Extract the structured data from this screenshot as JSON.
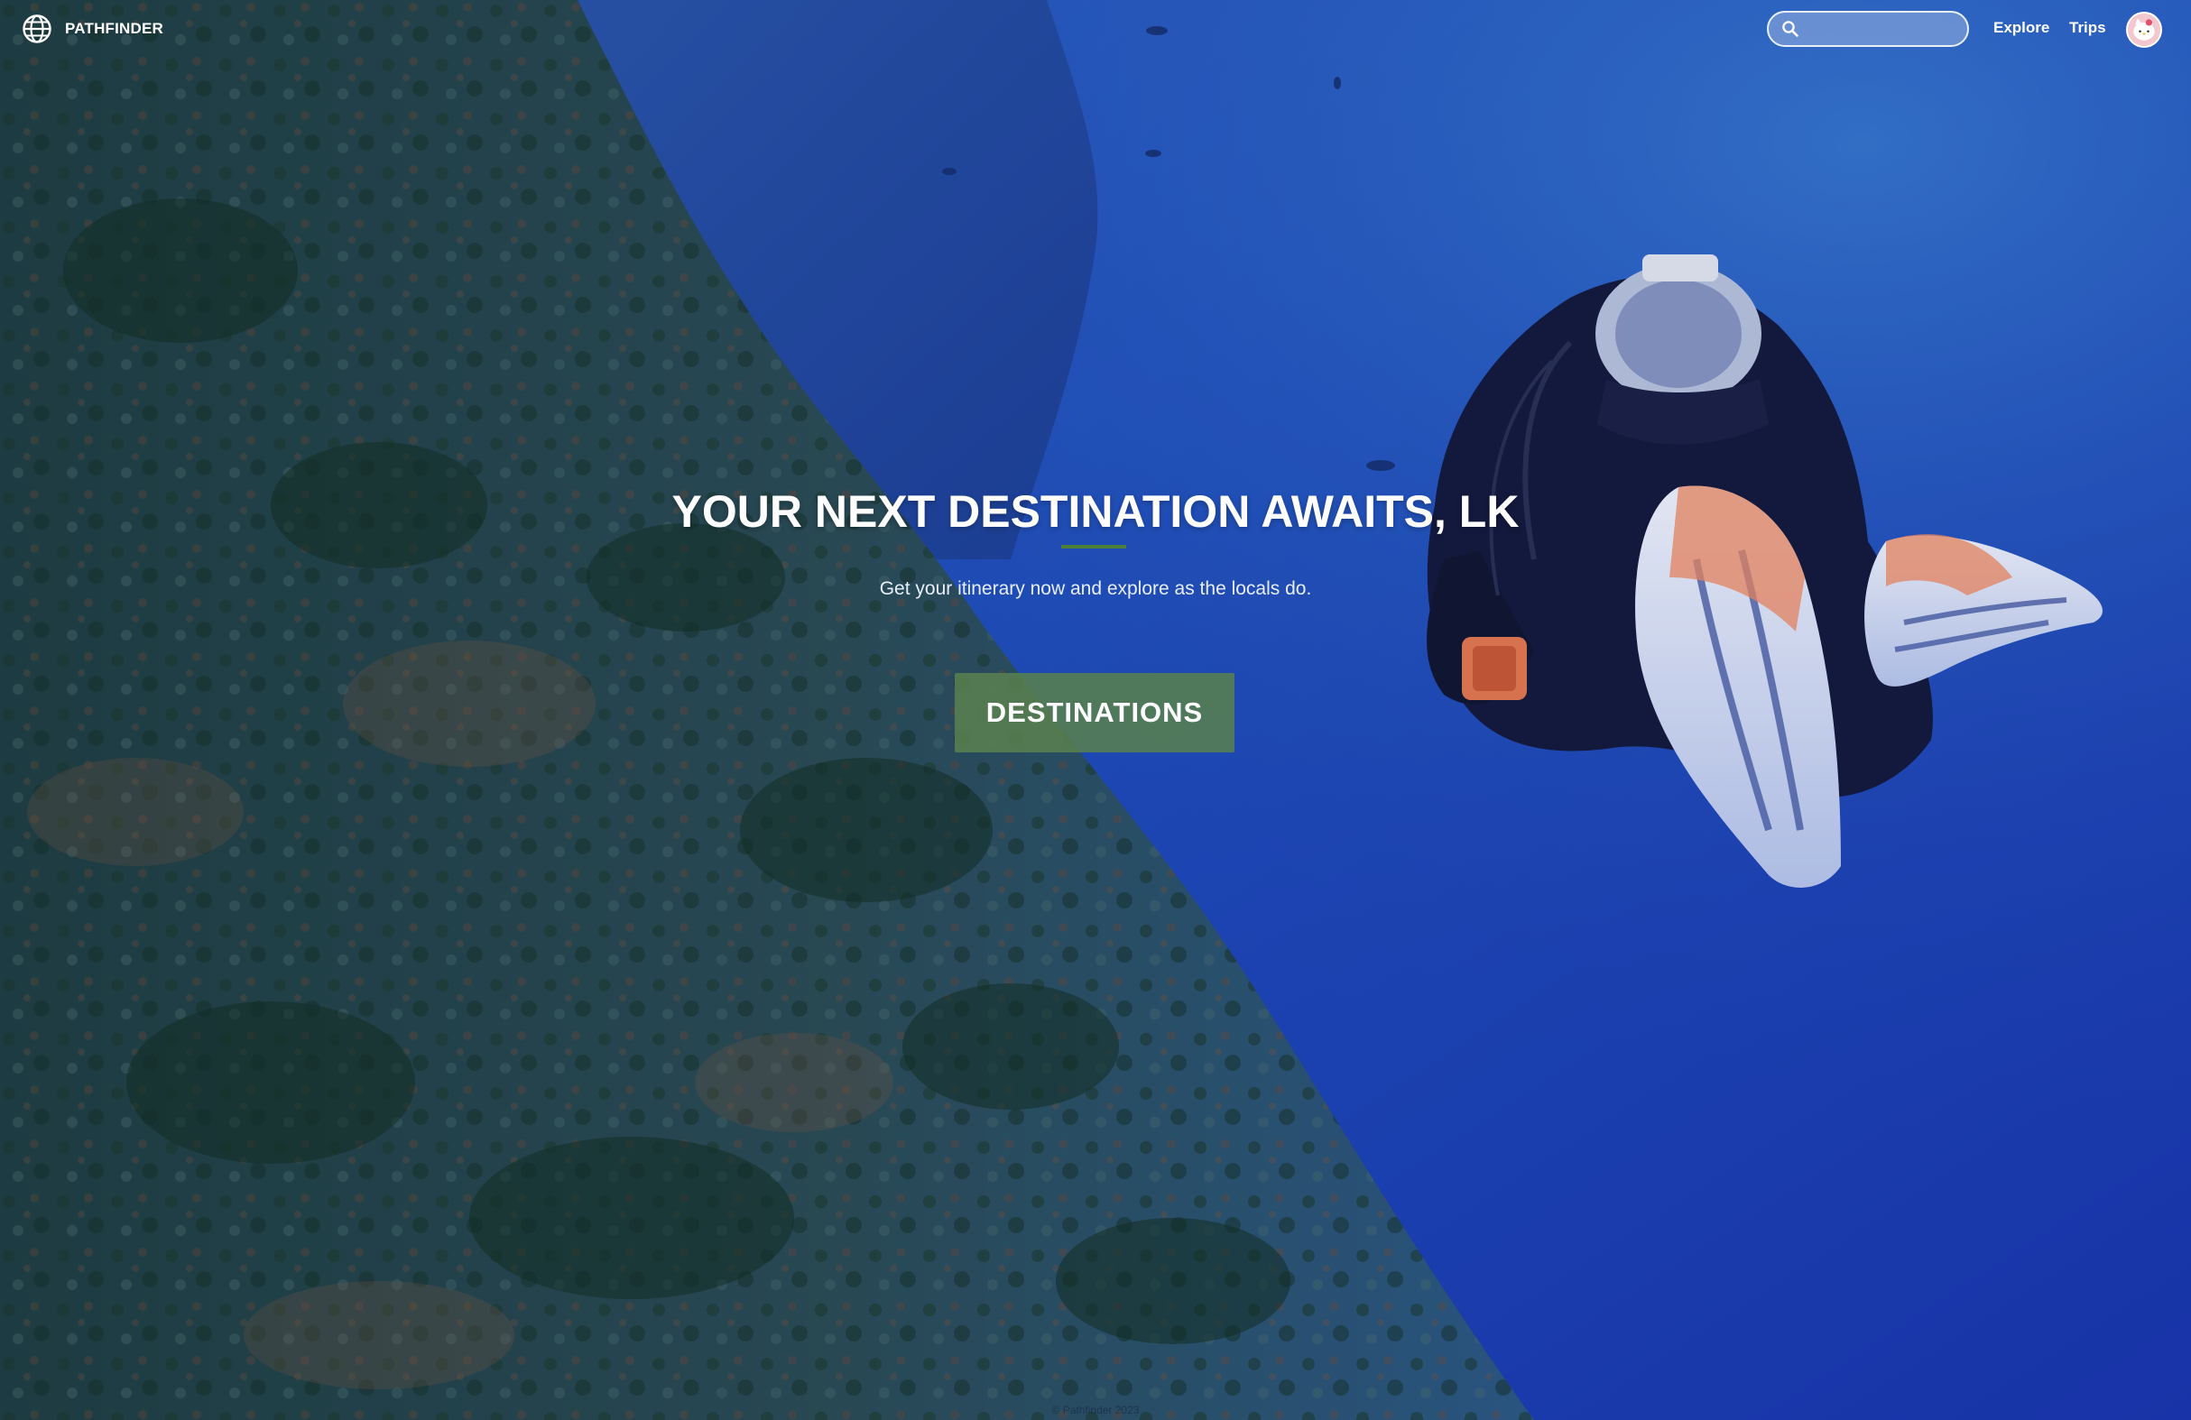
{
  "brand": {
    "name": "PATHFINDER",
    "icon": "globe-icon"
  },
  "nav": {
    "search_placeholder": "",
    "search_value": "",
    "search_icon": "search-icon",
    "links": [
      {
        "label": "Explore"
      },
      {
        "label": "Trips"
      }
    ],
    "avatar_icon": "avatar-icon"
  },
  "hero": {
    "title": "YOUR NEXT DESTINATION AWAITS, LK",
    "subtitle": "Get your itinerary now and explore as the locals do.",
    "cta_label": "DESTINATIONS",
    "background": "underwater-scuba-diver-photo"
  },
  "footer": {
    "note": "© Pathfinder 2023"
  },
  "colors": {
    "ocean": "#1d3fa8",
    "reef": "#2d4a52",
    "accent_green": "#4d7f3a",
    "button_green": "#588050",
    "text": "#ffffff"
  }
}
